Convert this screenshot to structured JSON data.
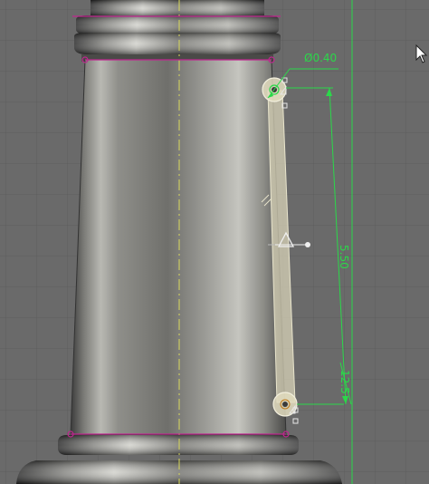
{
  "viewport": {
    "background": "#6a6a6a",
    "grid_color": "#5c5c5c",
    "accent_green": "#2bd84a",
    "sketch_magenta": "#c0268f",
    "centerline_yellow": "#d8d85a"
  },
  "dimensions": {
    "diameter_label": "Ø0.40",
    "vertical_label": "5.50",
    "angle_label": "12.5"
  },
  "constraint_icon": "triangle-constraint-icon",
  "cursor_icon": "arrow-cursor-icon"
}
